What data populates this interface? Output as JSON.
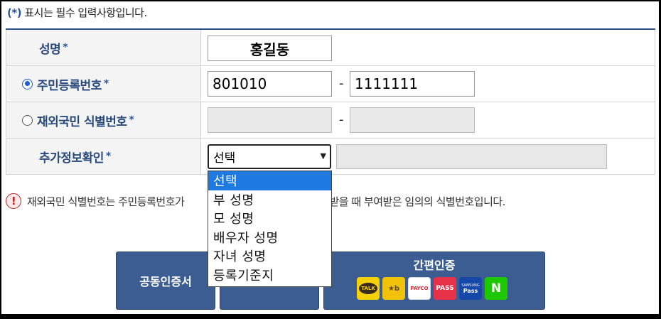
{
  "notice": {
    "prefix": "(",
    "star": "*",
    "suffix": ")",
    "text": " 표시는 필수 입력사항입니다."
  },
  "form": {
    "name": {
      "label": "성명",
      "req": "*",
      "value": "홍길동"
    },
    "rrn": {
      "label": "주민등록번호",
      "req": "*",
      "checked": true,
      "front": "801010",
      "dash": "-",
      "back": "1111111"
    },
    "foreign": {
      "label": "재외국민 식별번호",
      "req": "*",
      "checked": false,
      "front": "",
      "dash": "-",
      "back": ""
    },
    "extra": {
      "label": "추가정보확인",
      "req": "*",
      "selected": "선택",
      "arrow": "▼",
      "input": ""
    }
  },
  "dropdown": {
    "options": [
      "선택",
      "부 성명",
      "모 성명",
      "배우자 성명",
      "자녀 성명",
      "등록기준지"
    ],
    "highlighted": 0
  },
  "info": {
    "icon": "!",
    "text_before": "재외국민 식별번호는 주민등록번호가",
    "text_after": "를 발급받을 때 부여받은 임의의 식별번호입니다."
  },
  "buttons": {
    "cert": "공동인증서",
    "mid": "",
    "easy_title": "간편인증"
  },
  "auth_logos": [
    {
      "icon": "kakao-talk-logo",
      "label": "TALK"
    },
    {
      "icon": "kb-logo",
      "label": "★b"
    },
    {
      "icon": "payco-logo",
      "label": "PAYCO"
    },
    {
      "icon": "pass-logo",
      "label": "PASS"
    },
    {
      "icon": "samsung-pass-logo",
      "label": "Pass"
    },
    {
      "icon": "naver-logo",
      "label": "N"
    }
  ],
  "colors": {
    "primary": "#3c5d92",
    "label": "#2a4a7e",
    "highlight": "#1e7ae0"
  }
}
